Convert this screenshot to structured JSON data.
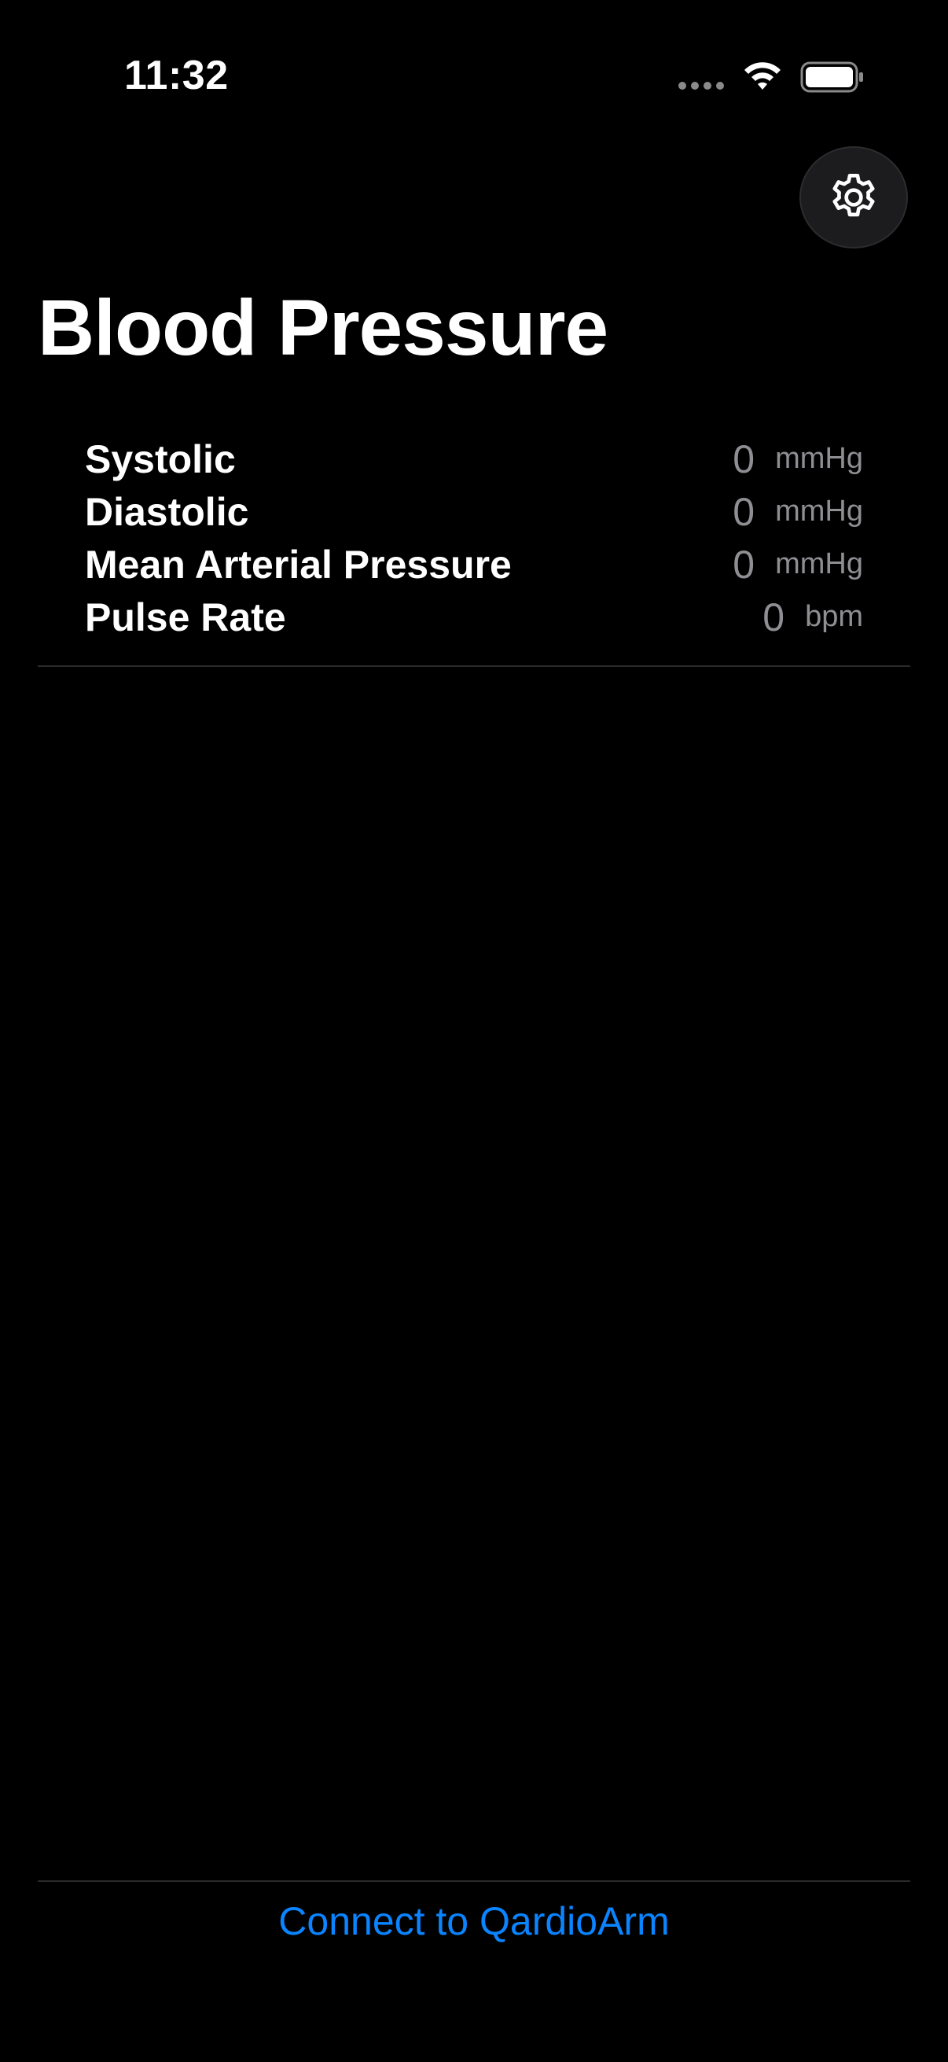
{
  "status_bar": {
    "time": "11:32"
  },
  "icons": {
    "settings": "gear-icon",
    "wifi": "wifi-icon",
    "battery": "battery-icon",
    "signal": "cellular-signal-icon"
  },
  "colors": {
    "background": "#000000",
    "accent": "#0a84ff",
    "secondary_text": "#8e8e93",
    "button_bg": "#1c1c1e"
  },
  "page": {
    "title": "Blood Pressure"
  },
  "metrics": [
    {
      "label": "Systolic",
      "value": "0",
      "unit": "mmHg"
    },
    {
      "label": "Diastolic",
      "value": "0",
      "unit": "mmHg"
    },
    {
      "label": "Mean Arterial Pressure",
      "value": "0",
      "unit": "mmHg"
    },
    {
      "label": "Pulse Rate",
      "value": "0",
      "unit": "bpm"
    }
  ],
  "footer": {
    "connect_label": "Connect to QardioArm"
  }
}
